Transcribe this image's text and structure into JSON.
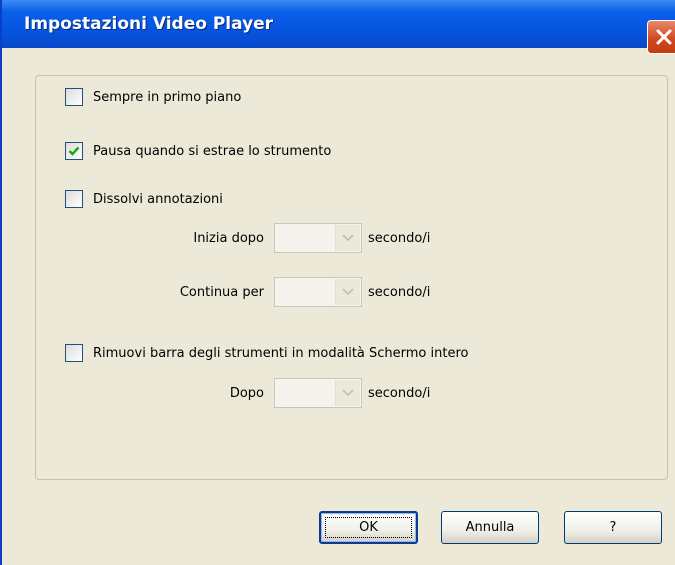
{
  "window": {
    "title": "Impostazioni Video Player"
  },
  "options": {
    "always_on_top": {
      "label": "Sempre in primo piano",
      "checked": false
    },
    "pause_on_extract": {
      "label": "Pausa quando si estrae lo strumento",
      "checked": true
    },
    "fade_annotations": {
      "label": "Dissolvi annotazioni",
      "checked": false
    },
    "remove_toolbar": {
      "label": "Rimuovi barra degli strumenti in modalità Schermo intero",
      "checked": false
    }
  },
  "fields": {
    "start_after": {
      "label": "Inizia dopo",
      "unit": "secondo/i",
      "value": ""
    },
    "continue_for": {
      "label": "Continua per",
      "unit": "secondo/i",
      "value": ""
    },
    "after": {
      "label": "Dopo",
      "unit": "secondo/i",
      "value": ""
    }
  },
  "buttons": {
    "ok": "OK",
    "cancel": "Annulla",
    "help": "?"
  },
  "colors": {
    "titlebar": "#0555e0",
    "check": "#21a121",
    "close": "#d0461d"
  },
  "icons": {
    "close": "close-icon",
    "check": "checkmark-icon",
    "dropdown": "chevron-down-icon"
  }
}
